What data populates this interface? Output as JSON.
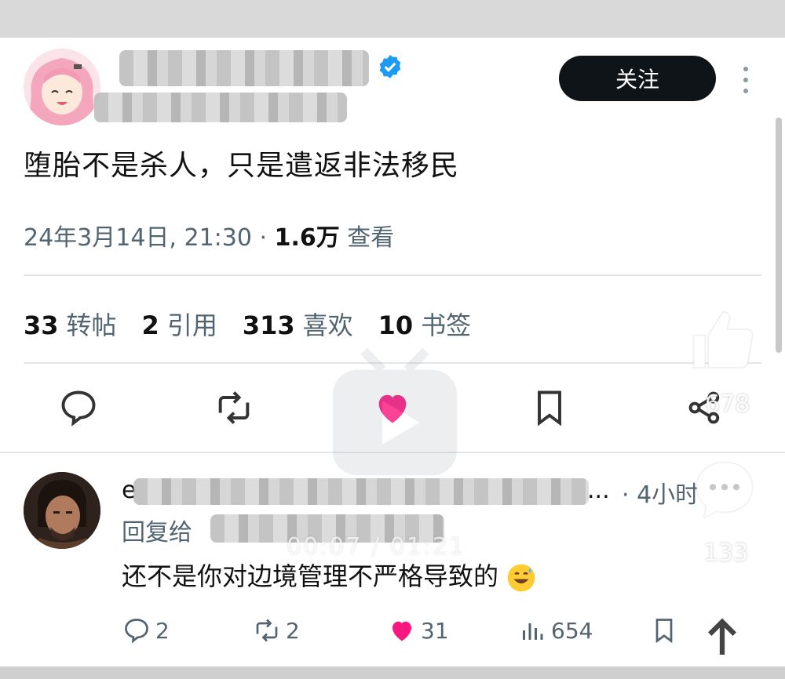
{
  "post": {
    "follow_label": "关注",
    "text": "堕胎不是杀人，只是遣返非法移民",
    "date_time": "24年3月14日, 21:30 · ",
    "views_count": "1.6万",
    "views_label": " 查看",
    "stats": [
      {
        "num": "33",
        "label": "转帖"
      },
      {
        "num": "2",
        "label": "引用"
      },
      {
        "num": "313",
        "label": "喜欢"
      },
      {
        "num": "10",
        "label": "书签"
      }
    ]
  },
  "reply": {
    "handle_visible": "e",
    "ellipsis": "...",
    "time": "· 4小时",
    "reply_to_label": "回复给",
    "text": "还不是你对边境管理不严格导致的",
    "actions": {
      "replies": "2",
      "retweets": "2",
      "likes": "31",
      "views": "654"
    }
  },
  "overlay": {
    "like_count": "678",
    "comment_count": "133",
    "video_time": "00:07 / 01:21"
  },
  "colors": {
    "like_pink": "#f91880",
    "verified_blue": "#1d9bf0",
    "button_dark": "#0f1419",
    "muted_text": "#536471"
  }
}
